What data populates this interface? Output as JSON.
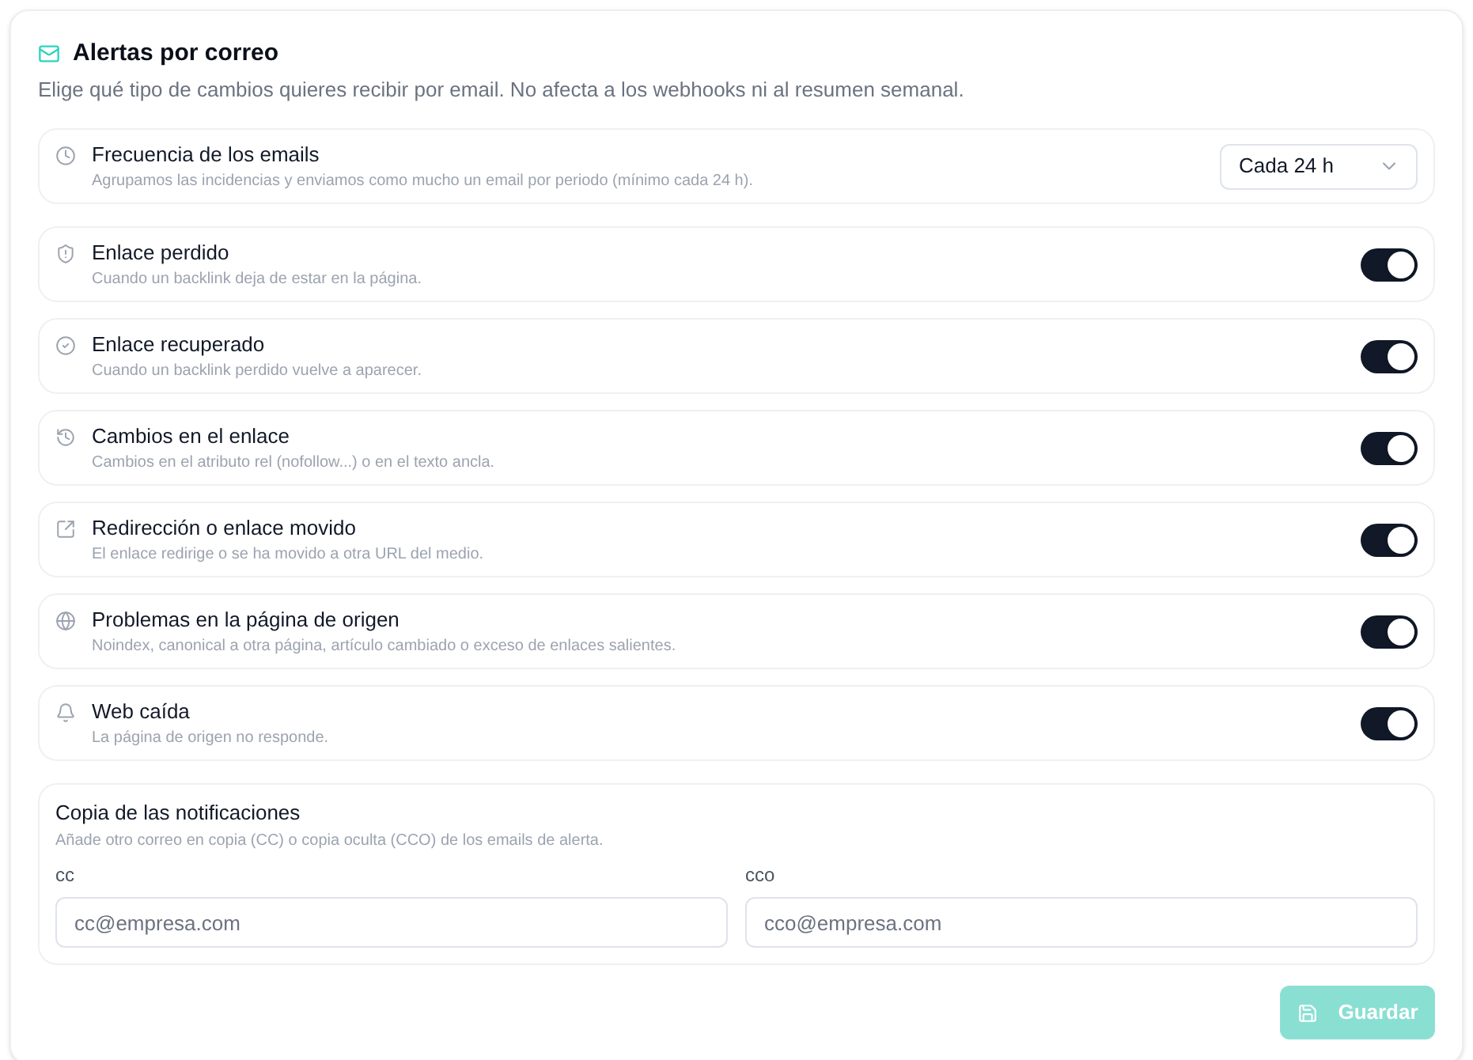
{
  "section": {
    "title": "Alertas por correo",
    "description": "Elige qué tipo de cambios quieres recibir por email. No afecta a los webhooks ni al resumen semanal."
  },
  "settings": [
    {
      "kind": "select",
      "title": "Frecuencia de los emails",
      "description": "Agrupamos las incidencias y enviamos como mucho un email por periodo (mínimo cada 24 h).",
      "value": "Cada 24 h"
    },
    {
      "kind": "toggle",
      "title": "Enlace perdido",
      "description": "Cuando un backlink deja de estar en la página.",
      "on": true
    },
    {
      "kind": "toggle",
      "title": "Enlace recuperado",
      "description": "Cuando un backlink perdido vuelve a aparecer.",
      "on": true
    },
    {
      "kind": "toggle",
      "title": "Cambios en el enlace",
      "description": "Cambios en el atributo rel (nofollow...) o en el texto ancla.",
      "on": true
    },
    {
      "kind": "toggle",
      "title": "Redirección o enlace movido",
      "description": "El enlace redirige o se ha movido a otra URL del medio.",
      "on": true
    },
    {
      "kind": "toggle",
      "title": "Problemas en la página de origen",
      "description": "Noindex, canonical a otra página, artículo cambiado o exceso de enlaces salientes.",
      "on": true
    },
    {
      "kind": "toggle",
      "title": "Web caída",
      "description": "La página de origen no responde.",
      "on": true
    }
  ],
  "copy": {
    "title": "Copia de las notificaciones",
    "description": "Añade otro correo en copia (CC) o copia oculta (CCO) de los emails de alerta.",
    "fields": [
      {
        "label": "cc",
        "placeholder": "cc@empresa.com"
      },
      {
        "label": "cco",
        "placeholder": "cco@empresa.com"
      }
    ]
  },
  "save_button": {
    "label": "Guardar",
    "disabled": true
  }
}
